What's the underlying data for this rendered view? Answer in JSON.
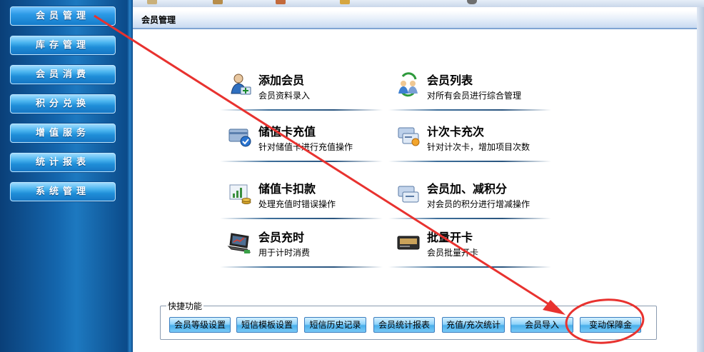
{
  "sidebar": {
    "items": [
      {
        "label": "会员管理"
      },
      {
        "label": "库存管理"
      },
      {
        "label": "会员消费"
      },
      {
        "label": "积分兑换"
      },
      {
        "label": "增值服务"
      },
      {
        "label": "统计报表"
      },
      {
        "label": "系统管理"
      }
    ]
  },
  "panel": {
    "title": "会员管理"
  },
  "cards": [
    {
      "title": "添加会员",
      "desc": "会员资料录入",
      "icon": "add-member-icon"
    },
    {
      "title": "会员列表",
      "desc": "对所有会员进行综合管理",
      "icon": "member-list-icon"
    },
    {
      "title": "储值卡充值",
      "desc": "针对储值卡进行充值操作",
      "icon": "card-recharge-icon"
    },
    {
      "title": "计次卡充次",
      "desc": "针对计次卡，增加项目次数",
      "icon": "count-card-icon"
    },
    {
      "title": "储值卡扣款",
      "desc": "处理充值时错误操作",
      "icon": "card-deduct-icon"
    },
    {
      "title": "会员加、减积分",
      "desc": "对会员的积分进行增减操作",
      "icon": "points-adjust-icon"
    },
    {
      "title": "会员充时",
      "desc": "用于计时消费",
      "icon": "laptop-icon"
    },
    {
      "title": "批量开卡",
      "desc": "会员批量开卡",
      "icon": "batch-card-icon"
    }
  ],
  "quick": {
    "legend": "快捷功能",
    "buttons": [
      {
        "label": "会员等级设置"
      },
      {
        "label": "短信模板设置"
      },
      {
        "label": "短信历史记录"
      },
      {
        "label": "会员统计报表"
      },
      {
        "label": "充值/充次统计"
      },
      {
        "label": "会员导入"
      },
      {
        "label": "变动保障金"
      }
    ]
  },
  "colors": {
    "sidebar_bg": "#1466ad",
    "nav_button": "#1f8ed8",
    "annotation_red": "#e8322f",
    "card_line": "#2a557f"
  }
}
